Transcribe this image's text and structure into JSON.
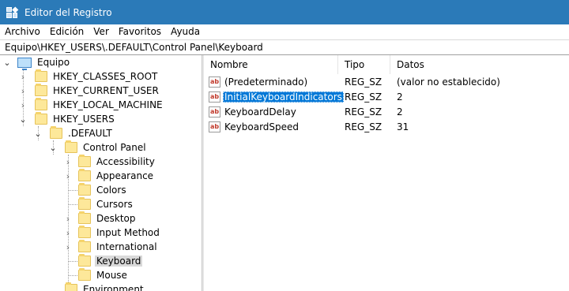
{
  "window": {
    "title": "Editor del Registro",
    "app_icon": "registry-editor-icon"
  },
  "menu": [
    "Archivo",
    "Edición",
    "Ver",
    "Favoritos",
    "Ayuda"
  ],
  "address": "Equipo\\HKEY_USERS\\.DEFAULT\\Control Panel\\Keyboard",
  "tree": {
    "root": "Equipo",
    "hives": [
      "HKEY_CLASSES_ROOT",
      "HKEY_CURRENT_USER",
      "HKEY_LOCAL_MACHINE",
      "HKEY_USERS"
    ],
    "default": ".DEFAULT",
    "control_panel": "Control Panel",
    "children": [
      "Accessibility",
      "Appearance",
      "Colors",
      "Cursors",
      "Desktop",
      "Input Method",
      "International",
      "Keyboard",
      "Mouse"
    ],
    "selected": "Keyboard",
    "next": "Environment"
  },
  "values": {
    "headers": {
      "name": "Nombre",
      "type": "Tipo",
      "data": "Datos"
    },
    "rows": [
      {
        "name": "(Predeterminado)",
        "type": "REG_SZ",
        "data": "(valor no establecido)",
        "icon": "string-value-icon"
      },
      {
        "name": "InitialKeyboardIndicators",
        "type": "REG_SZ",
        "data": "2",
        "icon": "string-value-icon",
        "selected": true
      },
      {
        "name": "KeyboardDelay",
        "type": "REG_SZ",
        "data": "2",
        "icon": "string-value-icon"
      },
      {
        "name": "KeyboardSpeed",
        "type": "REG_SZ",
        "data": "31",
        "icon": "string-value-icon"
      }
    ]
  },
  "colors": {
    "titlebar": "#2b7ab8",
    "selection": "#0078d7",
    "tree_selection": "#d9d9d9",
    "folder": "#fde89a"
  }
}
